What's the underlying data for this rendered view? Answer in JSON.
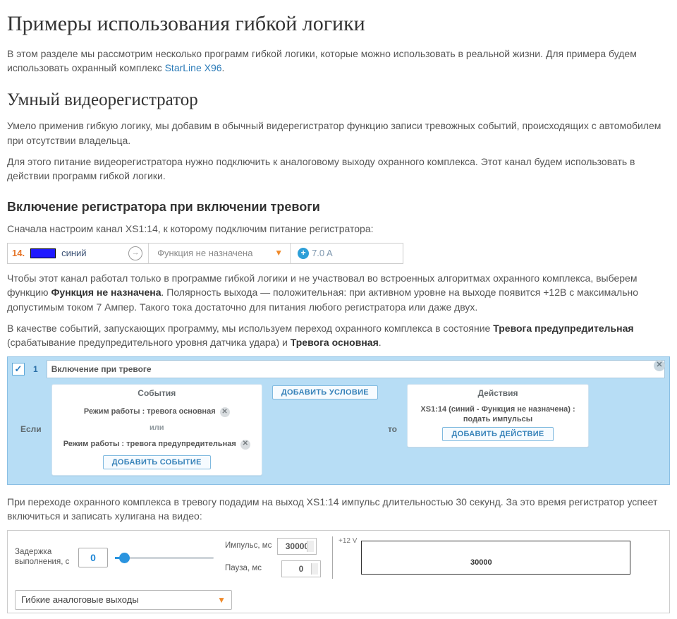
{
  "h1": "Примеры использования гибкой логики",
  "p1a": "В этом разделе мы рассмотрим несколько программ гибкой логики, которые можно использовать в реальной жизни. Для примера будем использовать охранный комплекс ",
  "p1_link": "StarLine X96",
  "p1b": ".",
  "h2": "Умный видеорегистратор",
  "p2": "Умело применив гибкую логику, мы добавим в обычный видерегистратор функцию записи тревожных событий, происходящих с автомобилем при отсутствии владельца.",
  "p3": "Для этого питание видеорегистратора нужно подключить к аналоговому выходу охранного комплекса. Этот канал будем использовать в действии программ гибкой логики.",
  "h3": "Включение регистратора при включении тревоги",
  "p4": "Сначала настроим канал XS1:14, к которому подключим питание регистратора:",
  "channel": {
    "num": "14.",
    "color_name": "синий",
    "func": "Функция не назначена",
    "amps": "7.0 A"
  },
  "p5a": "Чтобы этот канал работал только в программе гибкой логики и не участвовал во встроенных алгоритмах охранного комплекса, выберем функцию ",
  "p5_b1": "Функция не назначена",
  "p5b": ". Полярность выхода — положительная: при активном уровне на выходе появится +12В с максимально допустимым током 7 Ампер. Такого тока достаточно для питания любого регистратора или даже двух.",
  "p6a": "В качестве событий, запускающих программу, мы используем переход охранного комплекса в состояние ",
  "p6_b1": "Тревога предупредительная",
  "p6b": " (срабатывание предупредительного уровня датчика удара) и ",
  "p6_b2": "Тревога основная",
  "p6c": ".",
  "program": {
    "num": "1",
    "title": "Включение при тревоге",
    "if_kw": "Если",
    "then_kw": "то",
    "events_title": "События",
    "event1": "Режим работы : тревога основная",
    "or": "или",
    "event2": "Режим работы : тревога предупредительная",
    "add_event": "ДОБАВИТЬ СОБЫТИЕ",
    "add_cond": "ДОБАВИТЬ УСЛОВИЕ",
    "actions_title": "Действия",
    "action_text": "XS1:14 (синий - Функция не назначена) : подать импульсы",
    "add_action": "ДОБАВИТЬ ДЕЙСТВИЕ"
  },
  "p7": "При переходе охранного комплекса в тревогу подадим на выход XS1:14 импульс длительностью 30 секунд. За это время регистратор успеет включиться и записать хулигана на видео:",
  "impulse": {
    "delay_label": "Задержка выполнения, с",
    "delay_value": "0",
    "impulse_label": "Импульс, мс",
    "impulse_value": "30000",
    "pause_label": "Пауза, мс",
    "pause_value": "0",
    "dropdown": "Гибкие аналоговые выходы",
    "volt": "+12 V",
    "graph_label": "30000"
  }
}
